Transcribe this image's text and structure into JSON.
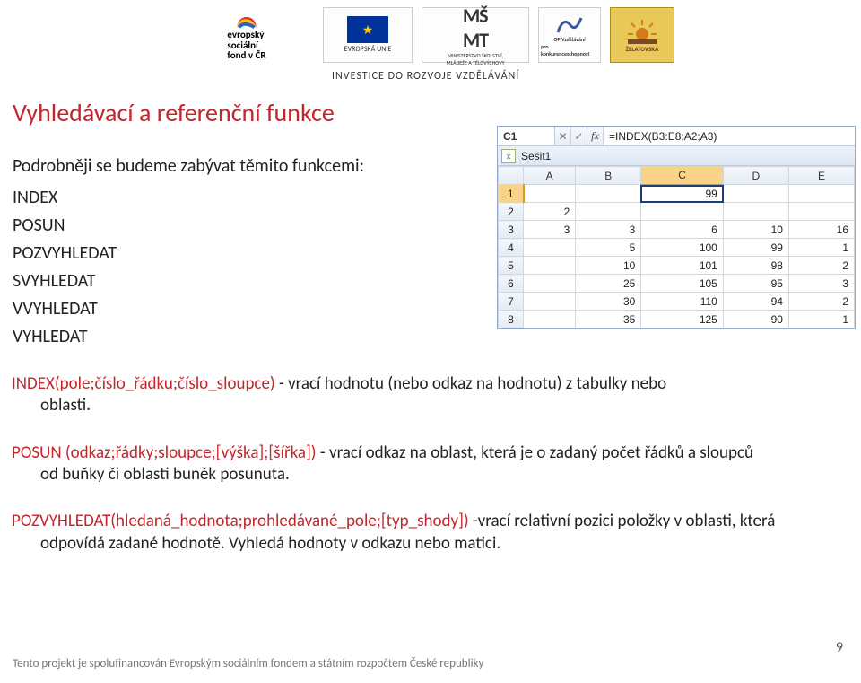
{
  "header": {
    "esf_line1": "evropský",
    "esf_line2": "sociální",
    "esf_line3": "fond v ČR",
    "eu_label": "EVROPSKÁ UNIE",
    "msmt_line1": "MINISTERSTVO ŠKOLSTVÍ,",
    "msmt_line2": "MLÁDEŽE A TĚLOVÝCHOVY",
    "opvk_line1": "OP Vzdělávání",
    "opvk_line2": "pro konkurenceschopnost",
    "zel_label": "ŽELATOVSKÁ",
    "investice": "INVESTICE DO ROZVOJE VZDĚLÁVÁNÍ"
  },
  "heading": "Vyhledávací a referenční funkce",
  "intro": {
    "lead": "Podrobněji se budeme zabývat těmito funkcemi:",
    "functions": [
      "INDEX",
      "POSUN",
      "POZVYHLEDAT",
      "SVYHLEDAT",
      "VVYHLEDAT",
      "VYHLEDAT"
    ]
  },
  "defs": {
    "d1_sig": "INDEX(pole;číslo_řádku;číslo_sloupce)",
    "d1_desc_a": " - vrací hodnotu (nebo odkaz na hodnotu) z tabulky nebo",
    "d1_cont": "oblasti.",
    "d2_sig": "POSUN (odkaz;řádky;sloupce;[výška];[šířka])",
    "d2_desc_a": " - vrací odkaz na oblast, která je o zadaný počet řádků a sloupců",
    "d2_cont": "od buňky či oblasti buněk posunuta.",
    "d3_sig": "POZVYHLEDAT(hledaná_hodnota;prohledávané_pole;[typ_shody])",
    "d3_desc_a": " -vrací relativní pozici položky v oblasti, která",
    "d3_cont": "odpovídá zadané hodnotě. Vyhledá hodnoty v odkazu nebo matici."
  },
  "sheet": {
    "namebox": "C1",
    "fx_cancel": "✕",
    "fx_enter": "✓",
    "fx_label": "fx",
    "formula": "=INDEX(B3:E8;A2;A3)",
    "tab_name": "Sešit1",
    "columns": [
      "A",
      "B",
      "C",
      "D",
      "E"
    ],
    "rows": [
      {
        "n": "1",
        "cells": [
          "",
          "",
          "99",
          "",
          ""
        ]
      },
      {
        "n": "2",
        "cells": [
          "2",
          "",
          "",
          "",
          ""
        ]
      },
      {
        "n": "3",
        "cells": [
          "3",
          "3",
          "6",
          "10",
          "16"
        ]
      },
      {
        "n": "4",
        "cells": [
          "",
          "5",
          "100",
          "99",
          "1"
        ]
      },
      {
        "n": "5",
        "cells": [
          "",
          "10",
          "101",
          "98",
          "2"
        ]
      },
      {
        "n": "6",
        "cells": [
          "",
          "25",
          "105",
          "95",
          "3"
        ]
      },
      {
        "n": "7",
        "cells": [
          "",
          "30",
          "110",
          "94",
          "2"
        ]
      },
      {
        "n": "8",
        "cells": [
          "",
          "35",
          "125",
          "90",
          "1"
        ]
      }
    ],
    "selected": {
      "row": 0,
      "col": 2
    }
  },
  "footer": {
    "text": "Tento projekt je spolufinancován Evropským sociálním fondem a státním rozpočtem České republiky",
    "page": "9"
  }
}
